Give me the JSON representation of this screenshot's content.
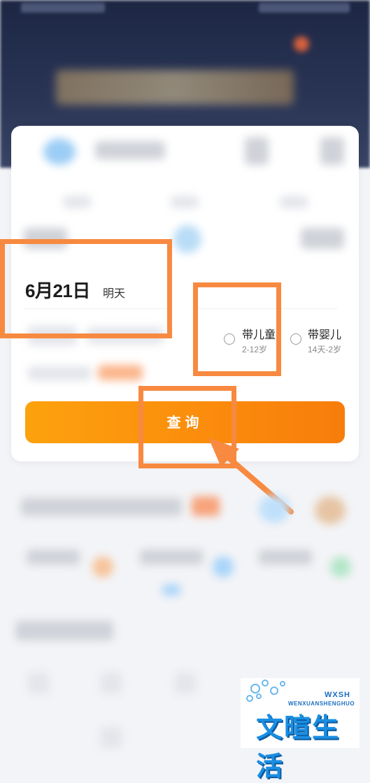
{
  "date": {
    "main": "6月21日",
    "relative": "明天"
  },
  "options": [
    {
      "label": "带儿童",
      "range": "2-12岁"
    },
    {
      "label": "带婴儿",
      "range": "14天-2岁"
    }
  ],
  "search": {
    "button_label": "查询"
  },
  "watermark": {
    "brand_cn": "文暄生活",
    "brand_en": "WENXUANSHENGHUO",
    "brand_abbr": "WXSH"
  },
  "colors": {
    "accent": "#fb8b0c",
    "highlight": "#f78a40",
    "brand_blue": "#1a8ee2"
  }
}
